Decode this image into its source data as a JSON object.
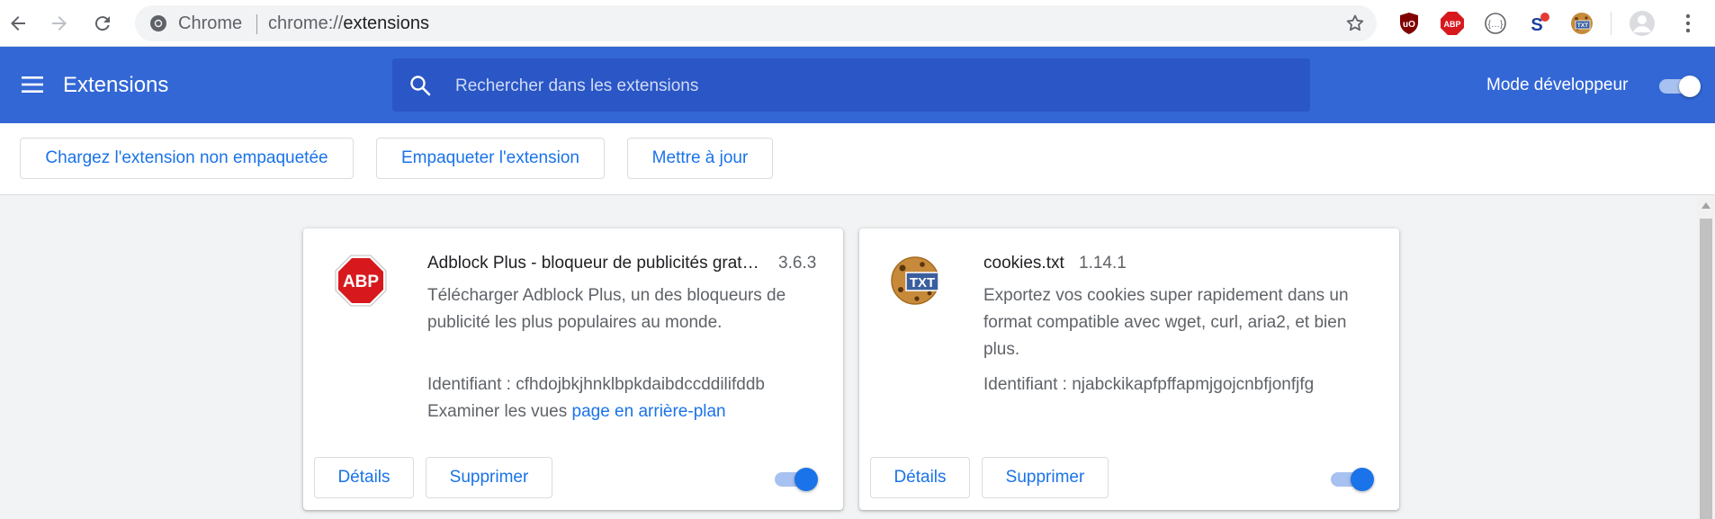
{
  "browser": {
    "site_label": "Chrome",
    "url_scheme": "chrome://",
    "url_host": "extensions",
    "toolbar_extensions": [
      {
        "name": "ublock-origin-icon",
        "text": "uO",
        "color": "#800000"
      },
      {
        "name": "adblock-plus-icon",
        "text": "ABP",
        "color": "#d7191e"
      },
      {
        "name": "code-brackets-icon",
        "text": "{…}",
        "color": "#5f6368"
      },
      {
        "name": "s-badge-icon",
        "text": "S",
        "color": "#1a3f9b"
      },
      {
        "name": "cookies-txt-icon",
        "text": "TXT",
        "color": "#c68a3a"
      }
    ]
  },
  "header": {
    "title": "Extensions",
    "search_placeholder": "Rechercher dans les extensions",
    "dev_mode_label": "Mode développeur",
    "dev_mode_on": true
  },
  "dev_toolbar": {
    "load_unpacked": "Chargez l'extension non empaquetée",
    "pack_extension": "Empaqueter l'extension",
    "update": "Mettre à jour"
  },
  "extensions": [
    {
      "name": "Adblock Plus - bloqueur de publicités grat…",
      "version": "3.6.3",
      "description": "Télécharger Adblock Plus, un des bloqueurs de publicité les plus populaires au monde.",
      "id_label": "Identifiant : cfhdojbkjhnklbpkdaibdccddilifddb",
      "views_label": "Examiner les vues",
      "views_link": "page en arrière-plan",
      "details": "Détails",
      "remove": "Supprimer",
      "enabled": true,
      "icon_text": "ABP"
    },
    {
      "name": "cookies.txt",
      "version": "1.14.1",
      "description": "Exportez vos cookies super rapidement dans un format compatible avec wget, curl, aria2, et bien plus.",
      "id_label": "Identifiant : njabckikapfpffapmjgojcnbfjonfjfg",
      "details": "Détails",
      "remove": "Supprimer",
      "enabled": true,
      "icon_text": "TXT"
    }
  ],
  "colors": {
    "header_bg": "#3367d6",
    "accent": "#1a73e8",
    "abp_red": "#d7191e"
  }
}
